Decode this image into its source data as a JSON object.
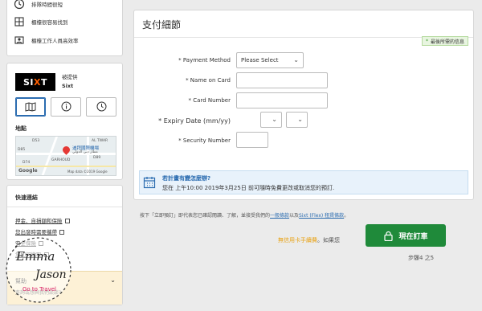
{
  "features": [
    {
      "icon": "clock-icon",
      "label": "排隊時間很短"
    },
    {
      "icon": "counter-icon",
      "label": "櫃檯很容易找到"
    },
    {
      "icon": "staff-icon",
      "label": "櫃檯工作人員高效率"
    }
  ],
  "supplier": {
    "logo_text": "SIXT",
    "supplied_by": "被提供",
    "name": "Sixt",
    "tabs": [
      {
        "name": "map-tab",
        "icon": "map-icon"
      },
      {
        "name": "info-tab",
        "icon": "info-icon"
      },
      {
        "name": "hours-tab",
        "icon": "clock-icon"
      }
    ],
    "location_label": "地點",
    "map": {
      "labels": [
        "D53",
        "AL TWAR",
        "D85",
        "迪拜國際機場",
        "مطار دبي الدولي",
        "GARHOUD",
        "D89",
        "D74"
      ],
      "copyright": "Map data ©2019 Google",
      "google": "Google"
    }
  },
  "quick_links": {
    "title": "快速連結",
    "items": [
      "押金、自損額和保險",
      "您出發時需要攜帶",
      "安全保險",
      "您如何繳取"
    ],
    "help": {
      "title": "幫助",
      "subtitle": "查詢或想與我們談談?"
    }
  },
  "payment": {
    "title": "支付細節",
    "required_note": "最後所需的信息",
    "fields": [
      {
        "label": "Payment Method",
        "type": "select",
        "value": "Please Select"
      },
      {
        "label": "Name on Card",
        "type": "text",
        "value": ""
      },
      {
        "label": "Card Number",
        "type": "text",
        "value": ""
      },
      {
        "label": "Expiry Date (mm/yy)",
        "type": "expiry",
        "value": ""
      },
      {
        "label": "Security Number",
        "type": "text",
        "value": ""
      }
    ],
    "info": {
      "title": "若計畫有變怎麼辦?",
      "text": "您在 上午10:00 2019年3月25日 前可隨時免費更改或取消您的預訂."
    }
  },
  "terms": {
    "prefix": "按下「立即預訂」即代表您已確認閱讀、了解，並接受我們的",
    "link1": "一般條款",
    "mid": "以及",
    "link2": "Sixt (Flex) 租賃條款",
    "suffix": "。"
  },
  "booking": {
    "nocard_highlight": "無信用卡手續費",
    "nocard_suffix": "。如果您",
    "button_label": "現在訂車",
    "step_text": "步驟4 之5"
  },
  "watermark": {
    "line1": "Emma",
    "line2": "Jason",
    "line3": "Go to Travel"
  },
  "colors": {
    "accent_green": "#1f8a3a",
    "link_blue": "#2b6cb0",
    "info_bg": "#e8f2fb",
    "help_bg": "#fdf1d6"
  }
}
